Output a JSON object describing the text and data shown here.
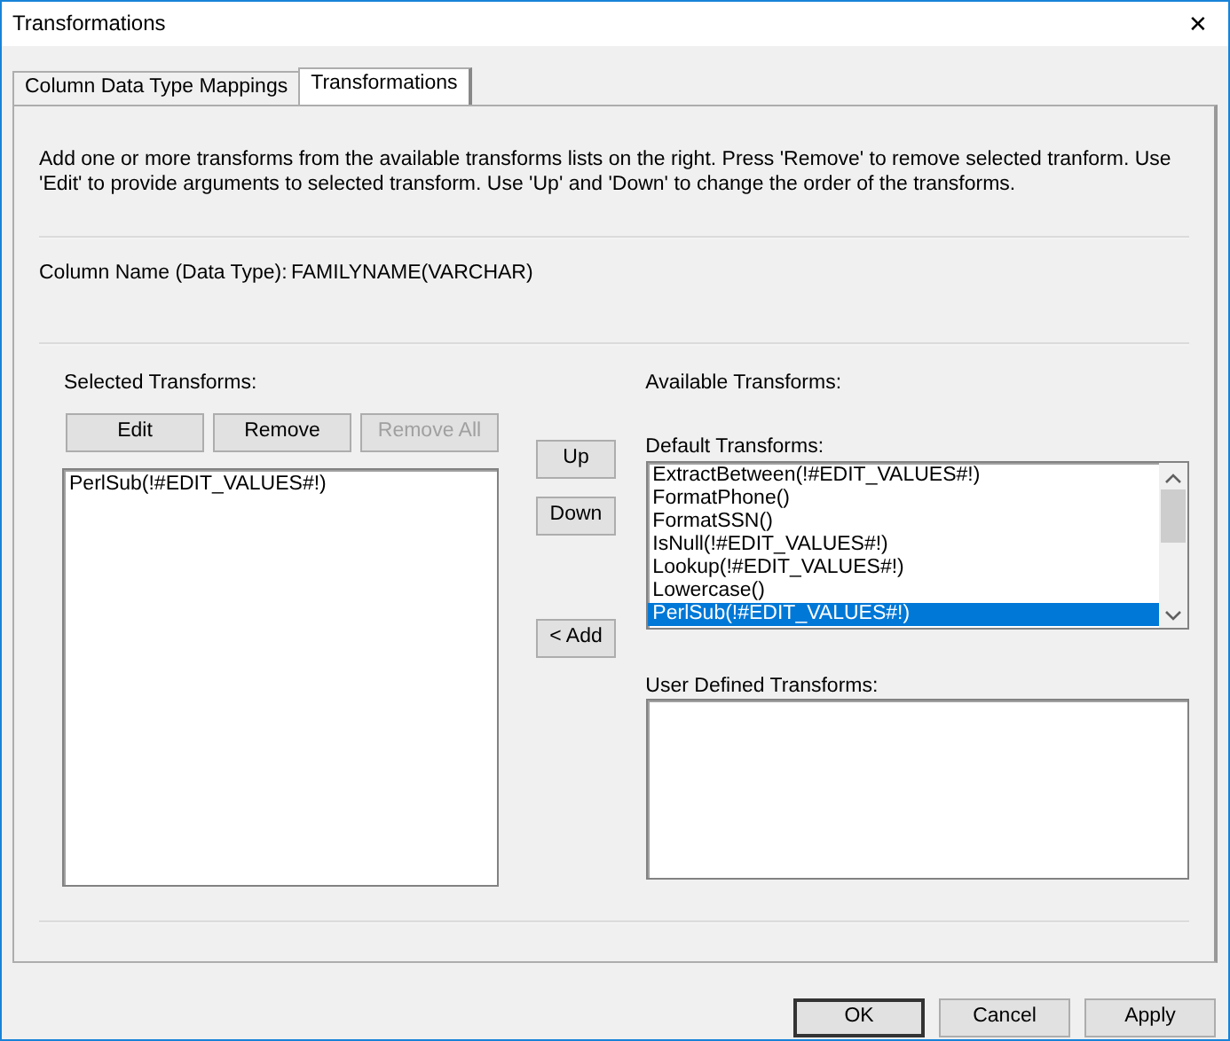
{
  "window": {
    "title": "Transformations",
    "close": "✕"
  },
  "tabs": [
    {
      "label": "Column Data Type Mappings",
      "selected": false
    },
    {
      "label": "Transformations",
      "selected": true
    }
  ],
  "description": "Add one or more transforms from the available transforms lists on the right. Press 'Remove' to remove selected tranform. Use 'Edit' to provide arguments to selected transform. Use 'Up' and 'Down' to change the order of the transforms.",
  "column_name": {
    "label": "Column Name (Data Type):",
    "value": "FAMILYNAME(VARCHAR)"
  },
  "selected_transforms": {
    "label": "Selected Transforms:",
    "buttons": [
      {
        "label": "Edit",
        "disabled": false
      },
      {
        "label": "Remove",
        "disabled": false
      },
      {
        "label": "Remove All",
        "disabled": true
      }
    ],
    "items": [
      {
        "label": "PerlSub(!#EDIT_VALUES#!)",
        "selected": false
      }
    ]
  },
  "move_buttons": [
    {
      "label": "Up",
      "disabled": false
    },
    {
      "label": "Down",
      "disabled": false
    },
    {
      "label": "< Add",
      "disabled": false
    }
  ],
  "available_transforms": {
    "label": "Available Transforms:",
    "default_label": "Default Transforms:",
    "default_items": [
      {
        "label": "ExtractBetween(!#EDIT_VALUES#!)",
        "selected": false
      },
      {
        "label": "FormatPhone()",
        "selected": false
      },
      {
        "label": "FormatSSN()",
        "selected": false
      },
      {
        "label": "IsNull(!#EDIT_VALUES#!)",
        "selected": false
      },
      {
        "label": "Lookup(!#EDIT_VALUES#!)",
        "selected": false
      },
      {
        "label": "Lowercase()",
        "selected": false
      },
      {
        "label": "PerlSub(!#EDIT_VALUES#!)",
        "selected": true
      }
    ],
    "user_label": "User Defined Transforms:"
  },
  "footer_buttons": [
    {
      "label": "OK",
      "default": true
    },
    {
      "label": "Cancel",
      "default": false
    },
    {
      "label": "Apply",
      "default": false
    }
  ]
}
